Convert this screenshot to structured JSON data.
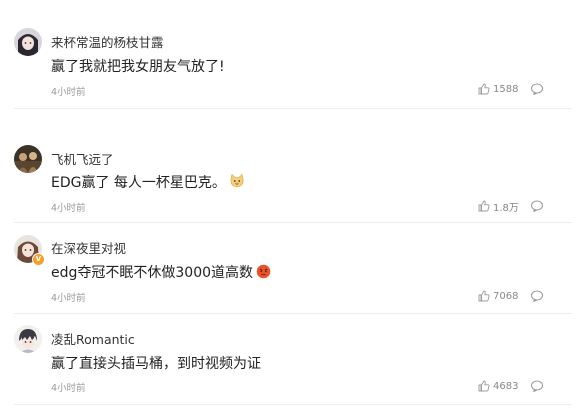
{
  "comments": [
    {
      "username": "来杯常温的杨枝甘露",
      "text": "赢了我就把我女朋友气放了!",
      "time": "4小时前",
      "likes": "1588",
      "avatar_icon": "anime-girl-avatar",
      "like_icon": "thumbs-up-icon",
      "reply_icon": "comment-bubble-icon"
    },
    {
      "username": "飞机飞远了",
      "text": "EDG赢了 每人一杯星巴克。",
      "emoji": "cat-face-emoji",
      "time": "4小时前",
      "likes": "1.8万",
      "avatar_icon": "photo-avatar"
    },
    {
      "username": "在深夜里对视",
      "text": "edg夺冠不眠不休做3000道高数",
      "emoji": "angry-face-emoji",
      "time": "4小时前",
      "likes": "7068",
      "avatar_icon": "girl-avatar",
      "verified_badge": "V"
    },
    {
      "username": "凌乱Romantic",
      "text": "赢了直接头插马桶，到时视频为证",
      "time": "4小时前",
      "likes": "4683",
      "avatar_icon": "anime-boy-avatar"
    }
  ],
  "colors": {
    "text": "#222222",
    "meta": "#999999",
    "divider": "#eeeeee",
    "badge": "#f4a02a"
  }
}
